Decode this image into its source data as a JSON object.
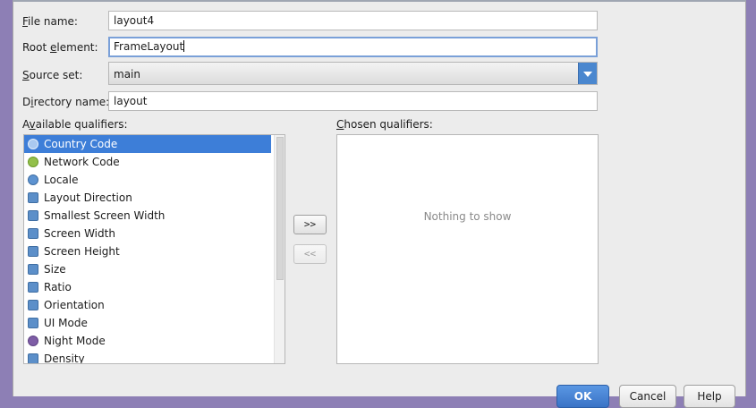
{
  "form": {
    "file_name": {
      "label_key": "F",
      "label_rest": "ile name:",
      "value": "layout4"
    },
    "root_element": {
      "label_pre": "Root ",
      "label_key": "e",
      "label_rest": "lement:",
      "value": "FrameLayout"
    },
    "source_set": {
      "label_key": "S",
      "label_rest": "ource set:",
      "value": "main"
    },
    "directory_name": {
      "label_pre": "D",
      "label_key": "i",
      "label_rest": "rectory name:",
      "value": "layout"
    }
  },
  "available": {
    "label_pre": "A",
    "label_key": "v",
    "label_rest": "ailable qualifiers:",
    "items": [
      {
        "label": "Country Code",
        "icon": "country-code-icon",
        "selected": true
      },
      {
        "label": "Network Code",
        "icon": "network-code-icon"
      },
      {
        "label": "Locale",
        "icon": "globe-icon"
      },
      {
        "label": "Layout Direction",
        "icon": "layout-direction-icon"
      },
      {
        "label": "Smallest Screen Width",
        "icon": "smallest-width-icon"
      },
      {
        "label": "Screen Width",
        "icon": "screen-width-icon"
      },
      {
        "label": "Screen Height",
        "icon": "screen-height-icon"
      },
      {
        "label": "Size",
        "icon": "size-icon"
      },
      {
        "label": "Ratio",
        "icon": "ratio-icon"
      },
      {
        "label": "Orientation",
        "icon": "orientation-icon"
      },
      {
        "label": "UI Mode",
        "icon": "ui-mode-icon"
      },
      {
        "label": "Night Mode",
        "icon": "night-mode-icon"
      },
      {
        "label": "Density",
        "icon": "density-icon"
      }
    ]
  },
  "chosen": {
    "label_key": "C",
    "label_rest": "hosen qualifiers:",
    "empty_text": "Nothing to show"
  },
  "transfer": {
    "add": ">>",
    "remove": "<<"
  },
  "footer": {
    "ok": "OK",
    "cancel": "Cancel",
    "help": "Help"
  },
  "colors": {
    "selection": "#3d7ed8",
    "accent": "#4a87cf",
    "background": "#ececec"
  }
}
